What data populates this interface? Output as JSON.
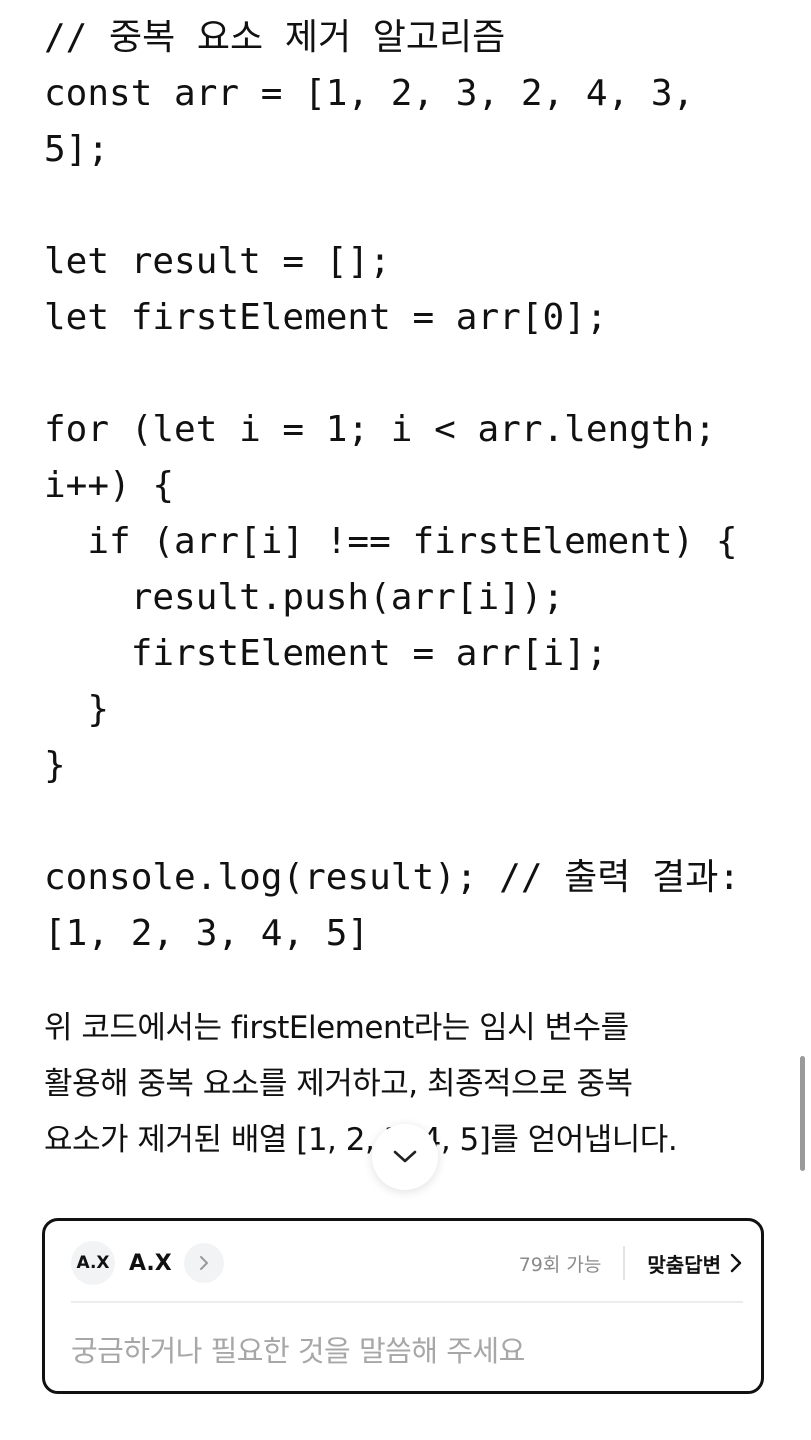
{
  "code": {
    "lines": [
      "// 중복 요소 제거 알고리즘",
      "const arr = [1, 2, 3, 2, 4, 3,",
      "5];",
      "",
      "let result = [];",
      "let firstElement = arr[0];",
      "",
      "for (let i = 1; i < arr.length;",
      "i++) {",
      "  if (arr[i] !== firstElement) {",
      "    result.push(arr[i]);",
      "    firstElement = arr[i];",
      "  }",
      "}",
      "",
      "console.log(result); // 출력 결과:",
      "[1, 2, 3, 4, 5]"
    ]
  },
  "explanation": {
    "lines": [
      "위 코드에서는 firstElement라는 임시 변수를",
      "활용해 중복 요소를 제거하고, 최종적으로 중복",
      "요소가 제거된 배열 [1, 2, 3, 4, 5]를 얻어냅니다."
    ]
  },
  "scroll_button": {
    "icon": "chevron-down-icon"
  },
  "chat": {
    "logo_text": "A.X",
    "assistant_name": "A.X",
    "usage_text": "79회 가능",
    "custom_answer_label": "맞춤답변",
    "input_placeholder": "궁금하거나 필요한 것을 말씀해 주세요",
    "input_value": ""
  },
  "colors": {
    "text": "#111111",
    "muted": "#8a8a8a",
    "placeholder": "#a7a7a7",
    "border": "#111111"
  }
}
